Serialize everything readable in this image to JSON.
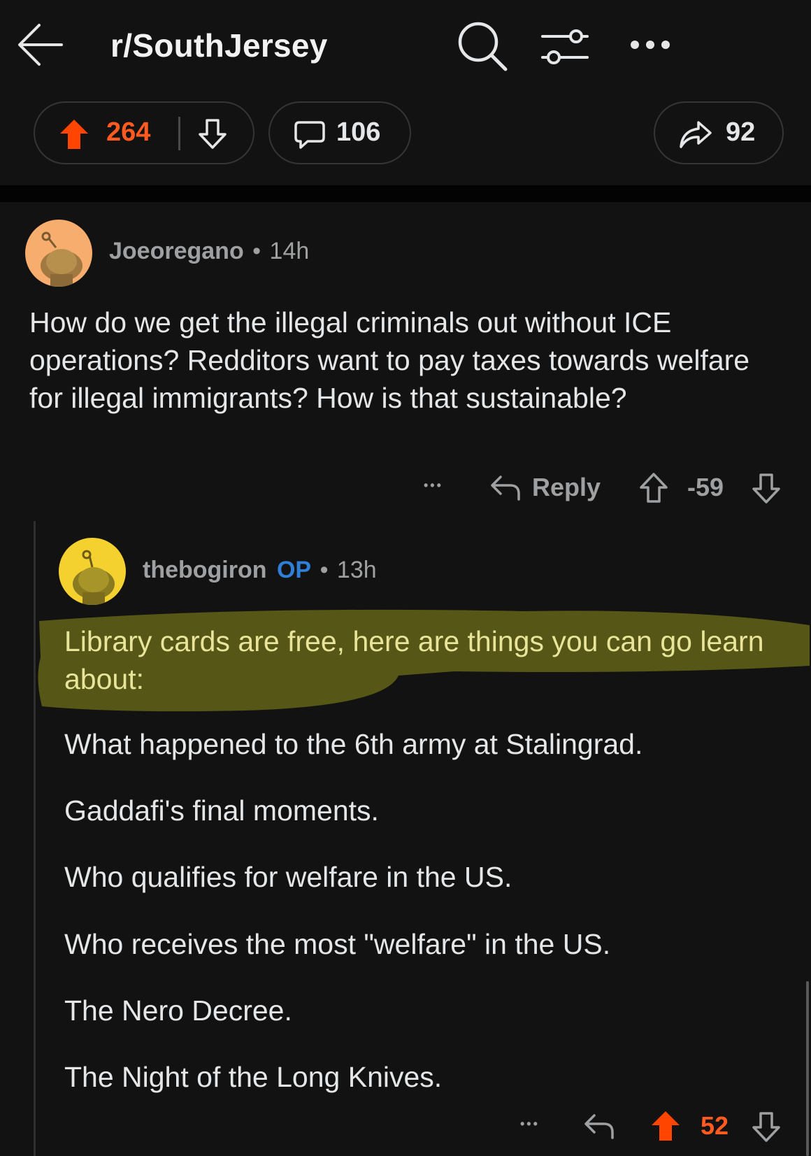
{
  "header": {
    "subreddit": "r/SouthJersey",
    "icons": [
      "back-arrow-icon",
      "search-icon",
      "filter-sliders-icon",
      "more-dots-icon"
    ]
  },
  "post_actions": {
    "upvotes": "264",
    "comments": "106",
    "shares": "92"
  },
  "comments": [
    {
      "author": "Joeoregano",
      "separator": "•",
      "time": "14h",
      "text": "How do we get the illegal criminals out without ICE operations?  Redditors want to pay taxes towards welfare for illegal immigrants?  How is that sustainable?",
      "more": "•••",
      "reply_label": "Reply",
      "score": "-59"
    },
    {
      "author": "thebogiron",
      "op_badge": "OP",
      "separator": "•",
      "time": "13h",
      "intro": "Library cards are free, here are things you can go learn about:",
      "items": [
        "What happened to the 6th army at Stalingrad.",
        "Gaddafi's final moments.",
        "Who qualifies for welfare in the US.",
        "Who receives the most \"welfare\" in the US.",
        "The Nero Decree.",
        "The Night of the Long Knives."
      ],
      "more": "•••",
      "score": "52"
    }
  ],
  "colors": {
    "background": "#121212",
    "upvote_orange": "#ff4500",
    "score_orange": "#ff5a1f",
    "op_blue": "#2f7fd6",
    "highlight_yellow": "#b4b41e",
    "avatar1": "#f6ad6d",
    "avatar2": "#f5d130"
  }
}
